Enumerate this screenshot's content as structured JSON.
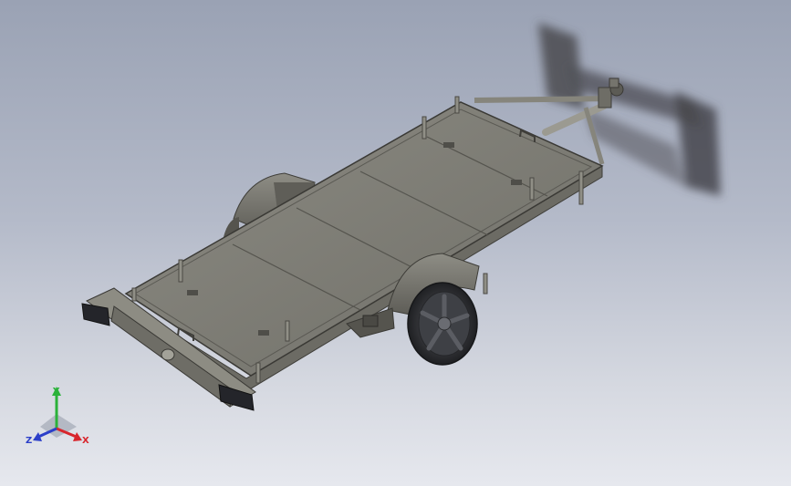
{
  "viewport": {
    "background_top": "#9aa2b4",
    "background_bottom": "#e6e8ee"
  },
  "model": {
    "deck_color": "#7b7b73",
    "frame_color": "#8b8a80",
    "tire_color": "#2a2b2e",
    "rim_color": "#4a4c52"
  },
  "triad": {
    "x_label": "X",
    "y_label": "Y",
    "z_label": "Z",
    "x_color": "#d8262d",
    "y_color": "#2bb23a",
    "z_color": "#2c3fc9"
  }
}
